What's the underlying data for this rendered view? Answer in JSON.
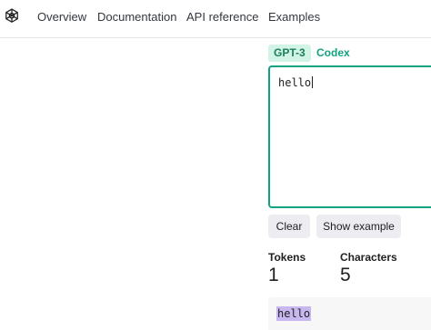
{
  "nav": {
    "items": [
      {
        "label": "Overview"
      },
      {
        "label": "Documentation"
      },
      {
        "label": "API reference"
      },
      {
        "label": "Examples"
      }
    ]
  },
  "tokenizer": {
    "tabs": [
      {
        "label": "GPT-3",
        "active": true
      },
      {
        "label": "Codex",
        "active": false
      }
    ],
    "input_value": "hello",
    "buttons": {
      "clear": "Clear",
      "show_example": "Show example"
    },
    "stats": {
      "tokens_label": "Tokens",
      "tokens_value": "1",
      "characters_label": "Characters",
      "characters_value": "5"
    },
    "tokenized_output": [
      "hello"
    ],
    "token_highlight_color": "#c9b8f0",
    "accent_color": "#10a37f"
  },
  "icons": {
    "logo": "openai-logo-icon"
  }
}
